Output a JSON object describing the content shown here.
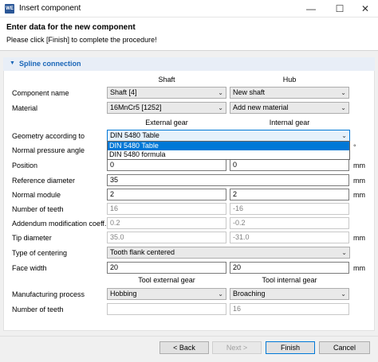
{
  "window": {
    "icon_label": "WE",
    "title": "Insert component",
    "minimize": "—",
    "maximize": "☐",
    "close": "✕"
  },
  "header": {
    "title": "Enter data for the new component",
    "subtitle": "Please click [Finish] to complete the procedure!"
  },
  "section": {
    "arrow": "▼",
    "title": "Spline connection"
  },
  "columns": {
    "shaft": "Shaft",
    "hub": "Hub",
    "external_gear": "External gear",
    "internal_gear": "Internal gear",
    "tool_external": "Tool external gear",
    "tool_internal": "Tool internal gear"
  },
  "labels": {
    "component_name": "Component name",
    "material": "Material",
    "geometry": "Geometry according to",
    "pressure_angle": "Normal pressure angle",
    "position": "Position",
    "reference_diameter": "Reference diameter",
    "normal_module": "Normal module",
    "number_of_teeth": "Number of teeth",
    "addendum": "Addendum modification coeff.",
    "tip_diameter": "Tip diameter",
    "type_centering": "Type of centering",
    "face_width": "Face width",
    "manufacturing": "Manufacturing process",
    "tool_teeth": "Number of teeth"
  },
  "units": {
    "position": "mm",
    "reference_diameter": "mm",
    "normal_module": "mm",
    "tip_diameter": "mm",
    "face_width": "mm",
    "pressure_angle": "°"
  },
  "values": {
    "shaft_name": "Shaft [4]",
    "hub_name": "New shaft",
    "shaft_material": "16MnCr5 [1252]",
    "hub_material": "Add new material",
    "geometry": "DIN 5480 Table",
    "position_ext": "0",
    "position_int": "0",
    "reference_diameter": "35",
    "module_ext": "2",
    "module_int": "2",
    "teeth_ext": "16",
    "teeth_int": "-16",
    "addendum_ext": "0.2",
    "addendum_int": "-0.2",
    "tip_ext": "35.0",
    "tip_int": "-31.0",
    "centering": "Tooth flank centered",
    "face_ext": "20",
    "face_int": "20",
    "process_ext": "Hobbing",
    "process_int": "Broaching",
    "tool_teeth_ext": "",
    "tool_teeth_int": "16"
  },
  "dropdown": {
    "options": [
      "DIN 5480 Table",
      "DIN 5480 formula"
    ]
  },
  "chevron": "⌄",
  "buttons": {
    "back": "< Back",
    "next": "Next >",
    "finish": "Finish",
    "cancel": "Cancel"
  }
}
